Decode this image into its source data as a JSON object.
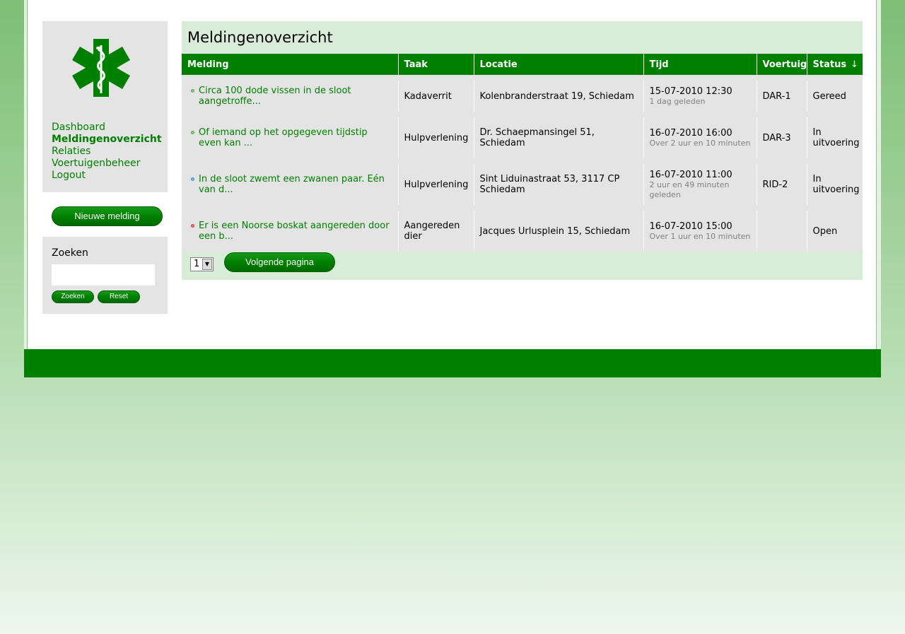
{
  "sidebar": {
    "nav": [
      {
        "label": "Dashboard",
        "active": false
      },
      {
        "label": "Meldingenoverzicht",
        "active": true
      },
      {
        "label": "Relaties",
        "active": false
      },
      {
        "label": "Voertuigenbeheer",
        "active": false
      },
      {
        "label": "Logout",
        "active": false
      }
    ],
    "new_button": "Nieuwe melding",
    "search": {
      "title": "Zoeken",
      "value": "",
      "search_button": "Zoeken",
      "reset_button": "Reset"
    }
  },
  "main": {
    "title": "Meldingenoverzicht",
    "columns": [
      "Melding",
      "Taak",
      "Locatie",
      "Tijd",
      "Voertuig",
      "Status"
    ],
    "sorted_column": "Status",
    "rows": [
      {
        "melding": "Circa 100 dode vissen in de sloot aangetroffe...",
        "dot_color": "#7fcf7f",
        "taak": "Kadaverrit",
        "locatie": "Kolenbranderstraat 19, Schiedam",
        "tijd": "15-07-2010 12:30",
        "tijd_sub": "1 dag geleden",
        "voertuig": "DAR-1",
        "status": "Gereed"
      },
      {
        "melding": "Of iemand op het opgegeven tijdstip even kan ...",
        "dot_color": "#7fcf7f",
        "taak": "Hulpverlening",
        "locatie": "Dr. Schaepmansingel 51, Schiedam",
        "tijd": "16-07-2010 16:00",
        "tijd_sub": "Over 2 uur en 10 minuten",
        "voertuig": "DAR-3",
        "status": "In uitvoering"
      },
      {
        "melding": "In de sloot zwemt een zwanen paar. Eén van d...",
        "dot_color": "#6fb7ef",
        "taak": "Hulpverlening",
        "locatie": "Sint Liduinastraat 53, 3117 CP Schiedam",
        "tijd": "16-07-2010 11:00",
        "tijd_sub": "2 uur en 49 minuten geleden",
        "voertuig": "RID-2",
        "status": "In uitvoering"
      },
      {
        "melding": "Er is een Noorse boskat aangereden door een b...",
        "dot_color": "#ef6f6f",
        "taak": "Aangereden dier",
        "locatie": "Jacques Urlusplein 15, Schiedam",
        "tijd": "16-07-2010 15:00",
        "tijd_sub": "Over 1 uur en 10 minuten",
        "voertuig": "",
        "status": "Open"
      }
    ],
    "pager": {
      "page": "1",
      "next_button": "Volgende pagina"
    }
  },
  "colors": {
    "brand": "#008000",
    "panel": "#e4e4e4",
    "main_bg": "#d9ecd8"
  },
  "icons": {
    "logo": "star-of-life-icon",
    "sort": "sort-down-icon",
    "dropdown": "dropdown-arrow-icon"
  }
}
